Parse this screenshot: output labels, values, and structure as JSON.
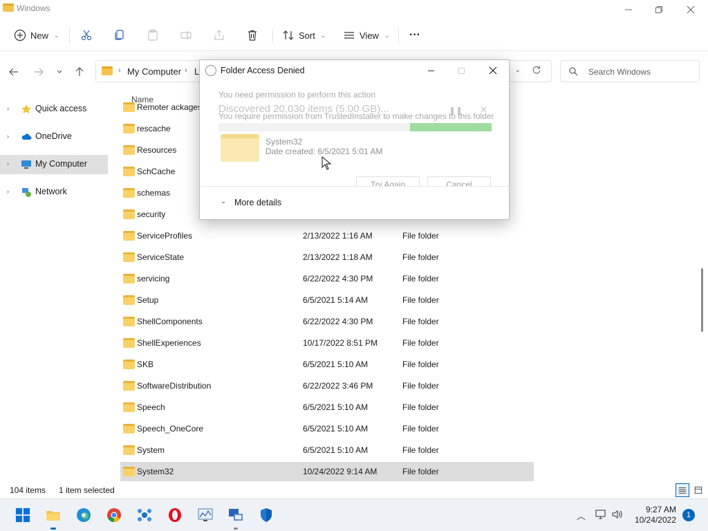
{
  "window": {
    "title": "Windows"
  },
  "commandbar": {
    "new_label": "New",
    "sort_label": "Sort",
    "view_label": "View",
    "more_label": "···"
  },
  "nav": {
    "breadcrumb": [
      "My Computer",
      "Lo"
    ],
    "search_placeholder": "Search Windows"
  },
  "sidebar": {
    "items": [
      {
        "label": "Quick access",
        "icon": "star-icon"
      },
      {
        "label": "OneDrive",
        "icon": "cloud-icon"
      },
      {
        "label": "My Computer",
        "icon": "computer-icon",
        "selected": true
      },
      {
        "label": "Network",
        "icon": "network-icon"
      }
    ]
  },
  "list": {
    "columns": {
      "name": "Name"
    },
    "rows": [
      {
        "name": "Remoter ackages",
        "date": "",
        "type": ""
      },
      {
        "name": "rescache",
        "date": "",
        "type": ""
      },
      {
        "name": "Resources",
        "date": "",
        "type": ""
      },
      {
        "name": "SchCache",
        "date": "",
        "type": ""
      },
      {
        "name": "schemas",
        "date": "",
        "type": ""
      },
      {
        "name": "security",
        "date": "",
        "type": ""
      },
      {
        "name": "ServiceProfiles",
        "date": "2/13/2022 1:16 AM",
        "type": "File folder"
      },
      {
        "name": "ServiceState",
        "date": "2/13/2022 1:18 AM",
        "type": "File folder"
      },
      {
        "name": "servicing",
        "date": "6/22/2022 4:30 PM",
        "type": "File folder"
      },
      {
        "name": "Setup",
        "date": "6/5/2021 5:14 AM",
        "type": "File folder"
      },
      {
        "name": "ShellComponents",
        "date": "6/22/2022 4:30 PM",
        "type": "File folder"
      },
      {
        "name": "ShellExperiences",
        "date": "10/17/2022 8:51 PM",
        "type": "File folder"
      },
      {
        "name": "SKB",
        "date": "6/5/2021 5:10 AM",
        "type": "File folder"
      },
      {
        "name": "SoftwareDistribution",
        "date": "6/22/2022 3:46 PM",
        "type": "File folder"
      },
      {
        "name": "Speech",
        "date": "6/5/2021 5:10 AM",
        "type": "File folder"
      },
      {
        "name": "Speech_OneCore",
        "date": "6/5/2021 5:10 AM",
        "type": "File folder"
      },
      {
        "name": "System",
        "date": "6/5/2021 5:10 AM",
        "type": "File folder"
      },
      {
        "name": "System32",
        "date": "10/24/2022 9:14 AM",
        "type": "File folder",
        "selected": true
      }
    ]
  },
  "status": {
    "count": "104 items",
    "selection": "1 item selected"
  },
  "dialog": {
    "title": "Folder Access Denied",
    "ghost_line1": "You need permission to perform this action",
    "ghost_discovered": "Discovered 20,030 items (5.00 GB)...",
    "ghost_permission": "You require permission from TrustedInstaller to make changes to this folder",
    "progress": 0.3,
    "folder_name": "System32",
    "folder_date": "Date created: 6/5/2021 5:01 AM",
    "try_again": "Try Again",
    "cancel": "Cancel",
    "more_details": "More details"
  },
  "taskbar": {
    "time": "9:27 AM",
    "date": "10/24/2022",
    "notification_count": "1"
  },
  "colors": {
    "accent": "#0067c0",
    "folder": "#f8d267",
    "progress": "#9fdc9f"
  }
}
